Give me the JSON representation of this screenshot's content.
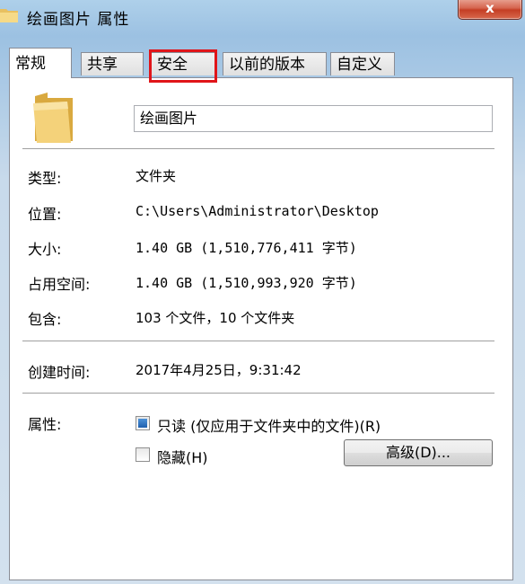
{
  "window": {
    "title": "绘画图片 属性",
    "close_label": "x"
  },
  "tabs": [
    {
      "label": "常规",
      "active": true
    },
    {
      "label": "共享",
      "active": false
    },
    {
      "label": "安全",
      "active": false,
      "highlighted": true
    },
    {
      "label": "以前的版本",
      "active": false
    },
    {
      "label": "自定义",
      "active": false
    }
  ],
  "general": {
    "name_value": "绘画图片",
    "properties": [
      {
        "label": "类型:",
        "value": "文件夹"
      },
      {
        "label": "位置:",
        "value": "C:\\Users\\Administrator\\Desktop"
      },
      {
        "label": "大小:",
        "value": "1.40 GB (1,510,776,411 字节)"
      },
      {
        "label": "占用空间:",
        "value": "1.40 GB (1,510,993,920 字节)"
      },
      {
        "label": "包含:",
        "value": "103 个文件，10 个文件夹"
      }
    ],
    "created_label": "创建时间:",
    "created_value": "2017年4月25日，9:31:42",
    "attributes_label": "属性:",
    "readonly_label": "只读 (仅应用于文件夹中的文件)(R)",
    "readonly_checked": true,
    "hidden_label": "隐藏(H)",
    "hidden_checked": false,
    "advanced_button": "高级(D)..."
  },
  "colors": {
    "highlight_border": "#e0151a",
    "checkbox_fill": "#1f5fae"
  },
  "icons": [
    "folder-icon",
    "close-icon"
  ]
}
